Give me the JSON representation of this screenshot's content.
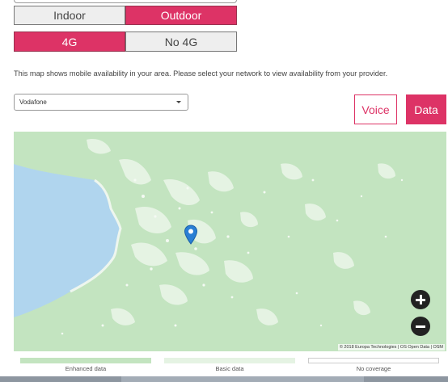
{
  "location_toggle": {
    "indoor_label": "Indoor",
    "outdoor_label": "Outdoor",
    "selected": "Outdoor"
  },
  "network_type_toggle": {
    "four_g_label": "4G",
    "no_four_g_label": "No 4G",
    "selected": "4G"
  },
  "description": "This map shows mobile availability in your area. Please select your network to view availability from your provider.",
  "network_select": {
    "value": "Vodafone",
    "icon": "caret-down-icon"
  },
  "service_toggle": {
    "voice_label": "Voice",
    "data_label": "Data",
    "selected": "Data"
  },
  "map": {
    "attribution": "© 2018 Europa Technologies | OS Open Data | OSM",
    "marker_icon": "map-pin-icon",
    "zoom_in_icon": "plus-circle-icon",
    "zoom_out_icon": "minus-circle-icon",
    "land_color": "#c3e4c0",
    "sea_color": "#b0d5ee"
  },
  "legend": {
    "enhanced_label": "Enhanced data",
    "basic_label": "Basic data",
    "none_label": "No coverage",
    "enhanced_color": "#c3e4c0",
    "basic_color": "#e5f3e3",
    "none_color": "#ffffff"
  },
  "colors": {
    "accent": "#dd3366"
  }
}
